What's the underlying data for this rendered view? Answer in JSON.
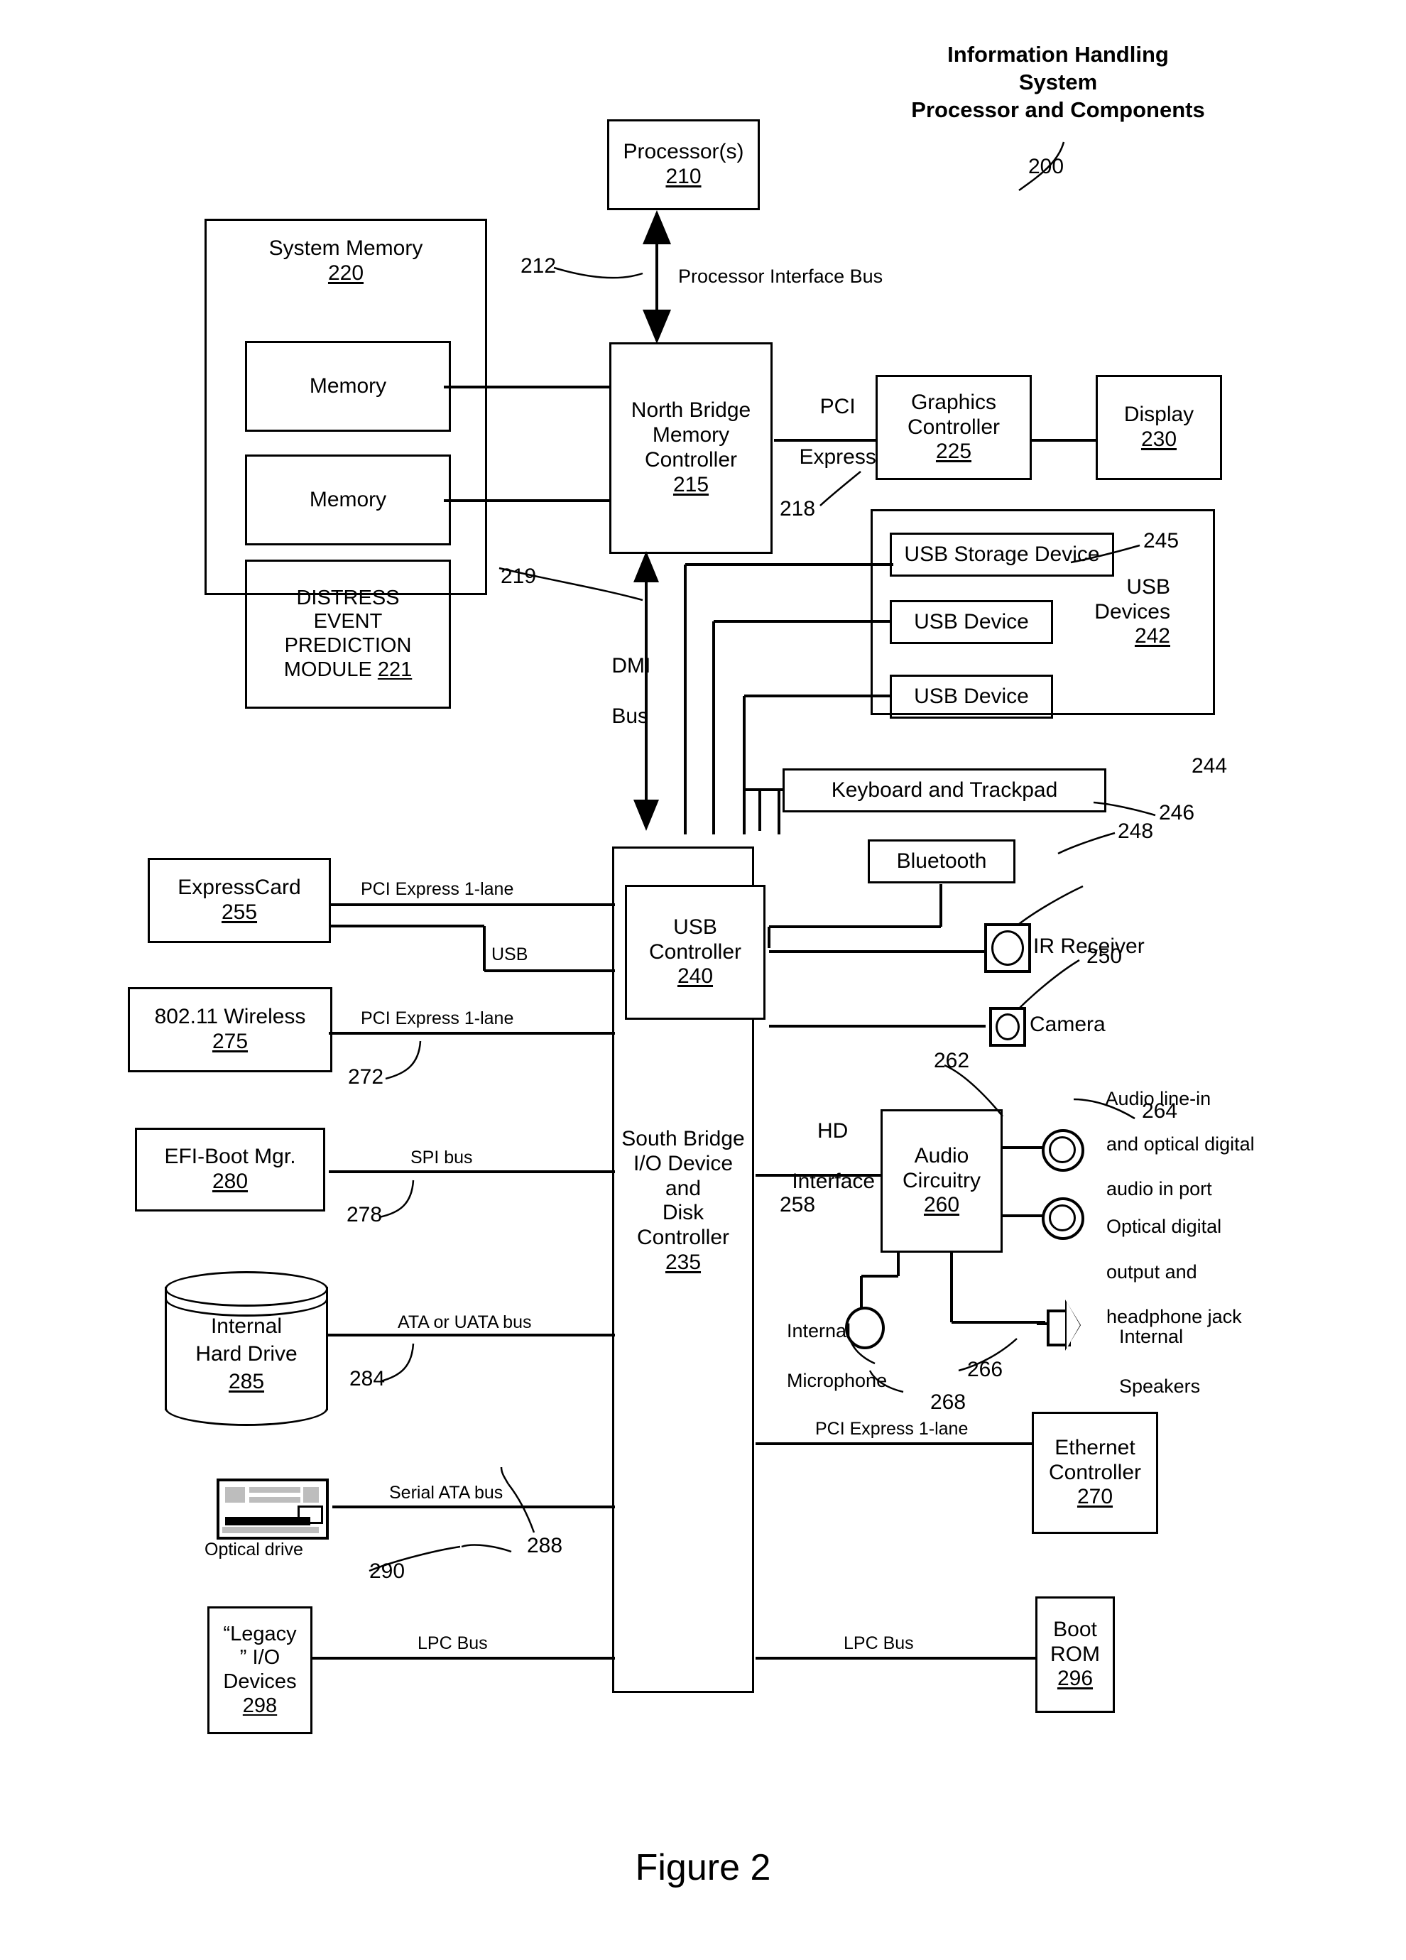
{
  "figure": {
    "caption": "Figure 2"
  },
  "title": {
    "line1": "Information Handling",
    "line2": "System",
    "line3": "Processor and Components",
    "ref": "200"
  },
  "blocks": {
    "processor": {
      "label": "Processor(s)",
      "ref": "210"
    },
    "system_memory": {
      "label": "System Memory",
      "ref": "220"
    },
    "memory_1": {
      "label": "Memory"
    },
    "memory_2": {
      "label": "Memory"
    },
    "distress_module": {
      "l1": "DISTRESS",
      "l2": "EVENT",
      "l3": "PREDICTION",
      "l4": "MODULE",
      "ref": "221"
    },
    "north_bridge": {
      "l1": "North Bridge",
      "l2": "Memory",
      "l3": "Controller",
      "ref": "215"
    },
    "graphics": {
      "l1": "Graphics",
      "l2": "Controller",
      "ref": "225"
    },
    "display": {
      "label": "Display",
      "ref": "230"
    },
    "usb_devices_group": {
      "l1": "USB",
      "l2": "Devices",
      "ref": "242"
    },
    "usb_storage": {
      "label": "USB Storage Device"
    },
    "usb_device_1": {
      "label": "USB Device"
    },
    "usb_device_2": {
      "label": "USB Device"
    },
    "keyboard": {
      "label": "Keyboard and Trackpad"
    },
    "bluetooth": {
      "label": "Bluetooth"
    },
    "ir_receiver": {
      "label": "IR Receiver"
    },
    "camera": {
      "label": "Camera"
    },
    "usb_controller": {
      "l1": "USB",
      "l2": "Controller",
      "ref": "240"
    },
    "south_bridge": {
      "l1": "South Bridge",
      "l2": "I/O Device",
      "l3": "and",
      "l4": "Disk",
      "l5": "Controller",
      "ref": "235"
    },
    "expresscard": {
      "label": "ExpressCard",
      "ref": "255"
    },
    "wireless": {
      "label": "802.11 Wireless",
      "ref": "275"
    },
    "efi_boot_mgr": {
      "label": "EFI-Boot Mgr.",
      "ref": "280"
    },
    "hard_drive": {
      "l1": "Internal",
      "l2": "Hard Drive",
      "ref": "285"
    },
    "optical_drive": {
      "label": "Optical drive",
      "ref": "290"
    },
    "legacy_io": {
      "l1": "“Legacy",
      "l2": "” I/O",
      "l3": "Devices",
      "ref": "298"
    },
    "audio_circuitry": {
      "l1": "Audio",
      "l2": "Circuitry",
      "ref": "260"
    },
    "audio_line_in": {
      "l1": "Audio line-in",
      "l2": "and optical digital",
      "l3": "audio in port",
      "ref": "262"
    },
    "optical_out": {
      "l1": "Optical digital",
      "l2": "output and",
      "l3": "headphone jack",
      "ref": "264"
    },
    "internal_mic": {
      "l1": "Internal",
      "l2": "Microphone",
      "ref": "268"
    },
    "internal_speakers": {
      "l1": "Internal",
      "l2": "Speakers",
      "ref": "266"
    },
    "ethernet": {
      "l1": "Ethernet",
      "l2": "Controller",
      "ref": "270"
    },
    "boot_rom": {
      "l1": "Boot",
      "l2": "ROM",
      "ref": "296"
    }
  },
  "buses": {
    "processor_interface": {
      "label": "Processor Interface Bus",
      "ref": "212"
    },
    "pci_express": {
      "l1": "PCI",
      "l2": "Express",
      "ref": "218"
    },
    "dmi": {
      "l1": "DMI",
      "l2": "Bus",
      "ref": "219"
    },
    "usb_devices_ref": {
      "ref": "244"
    },
    "usb_storage_ref": {
      "ref": "245"
    },
    "bluetooth_ref": {
      "ref": "246"
    },
    "ir_ref": {
      "ref": "248"
    },
    "camera_ref": {
      "ref": "250"
    },
    "expresscard_pcie": {
      "label": "PCI Express 1-lane"
    },
    "expresscard_usb": {
      "label": "USB"
    },
    "wireless_pcie": {
      "label": "PCI Express 1-lane",
      "ref": "272"
    },
    "spi": {
      "label": "SPI bus",
      "ref": "278"
    },
    "ata": {
      "label": "ATA or UATA bus",
      "ref": "284"
    },
    "sata": {
      "label": "Serial ATA bus",
      "ref": "288"
    },
    "lpc_left": {
      "label": "LPC Bus"
    },
    "lpc_right": {
      "label": "LPC Bus"
    },
    "hd_interface": {
      "l1": "HD",
      "l2": "Interface",
      "ref": "258"
    },
    "ethernet_pcie": {
      "label": "PCI Express 1-lane"
    }
  }
}
